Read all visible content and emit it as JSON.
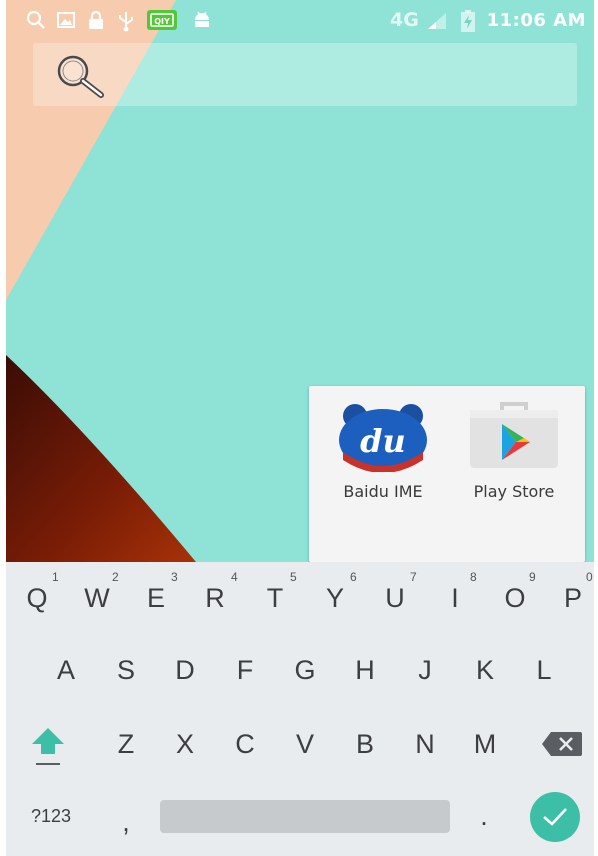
{
  "status_bar": {
    "network": "4G",
    "time": "11:06 AM",
    "notification_icons": [
      "search-icon",
      "image-icon",
      "lock-icon",
      "usb-icon",
      "iqiyi-icon",
      "android-icon"
    ]
  },
  "search_bar": {
    "icon": "magnifier-icon"
  },
  "folder": {
    "apps": [
      {
        "label": "Baidu IME",
        "icon": "baidu-ime-icon",
        "icon_text": "du"
      },
      {
        "label": "Play Store",
        "icon": "play-store-icon"
      }
    ]
  },
  "keyboard": {
    "row1": [
      "Q",
      "W",
      "E",
      "R",
      "T",
      "Y",
      "U",
      "I",
      "O",
      "P"
    ],
    "row1_hints": [
      "1",
      "2",
      "3",
      "4",
      "5",
      "6",
      "7",
      "8",
      "9",
      "0"
    ],
    "row2": [
      "A",
      "S",
      "D",
      "F",
      "G",
      "H",
      "J",
      "K",
      "L"
    ],
    "row3": [
      "Z",
      "X",
      "C",
      "V",
      "B",
      "N",
      "M"
    ],
    "symbols_label": "?123",
    "comma": ",",
    "period": ".",
    "accent_color": "#3dbea6"
  }
}
